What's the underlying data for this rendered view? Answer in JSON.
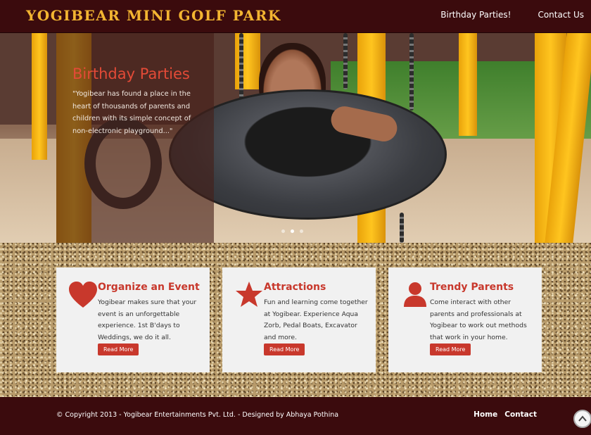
{
  "header": {
    "logo": "YOGIBEAR MINI GOLF PARK",
    "nav": [
      "Birthday Parties!",
      "Contact Us"
    ]
  },
  "hero": {
    "title": "Birthday Parties",
    "text": "\"Yogibear has found a place in the heart of thousands of parents and children with its simple concept of non-electronic playground...\"",
    "slides": 3,
    "active_slide": 1
  },
  "features": [
    {
      "icon": "heart-icon",
      "title": "Organize an Event",
      "text": "Yogibear makes sure that your event is an unforgettable experience. 1st B'days to Weddings, we do it all.",
      "button": "Read More"
    },
    {
      "icon": "star-icon",
      "title": "Attractions",
      "text": "Fun and learning come together at Yogibear. Experience Aqua Zorb, Pedal Boats, Excavator and more.",
      "button": "Read More"
    },
    {
      "icon": "user-icon",
      "title": "Trendy Parents",
      "text": "Come interact with other parents and professionals at Yogibear to work out methods that work in your home.",
      "button": "Read More"
    }
  ],
  "footer": {
    "copyright": "© Copyright 2013 - Yogibear Entertainments Pvt. Ltd. - Designed by Abhaya Pothina",
    "nav": [
      "Home",
      "Contact"
    ]
  },
  "colors": {
    "brand_dark": "#3b0b0d",
    "logo": "#f3b531",
    "accent": "#c8382c"
  }
}
